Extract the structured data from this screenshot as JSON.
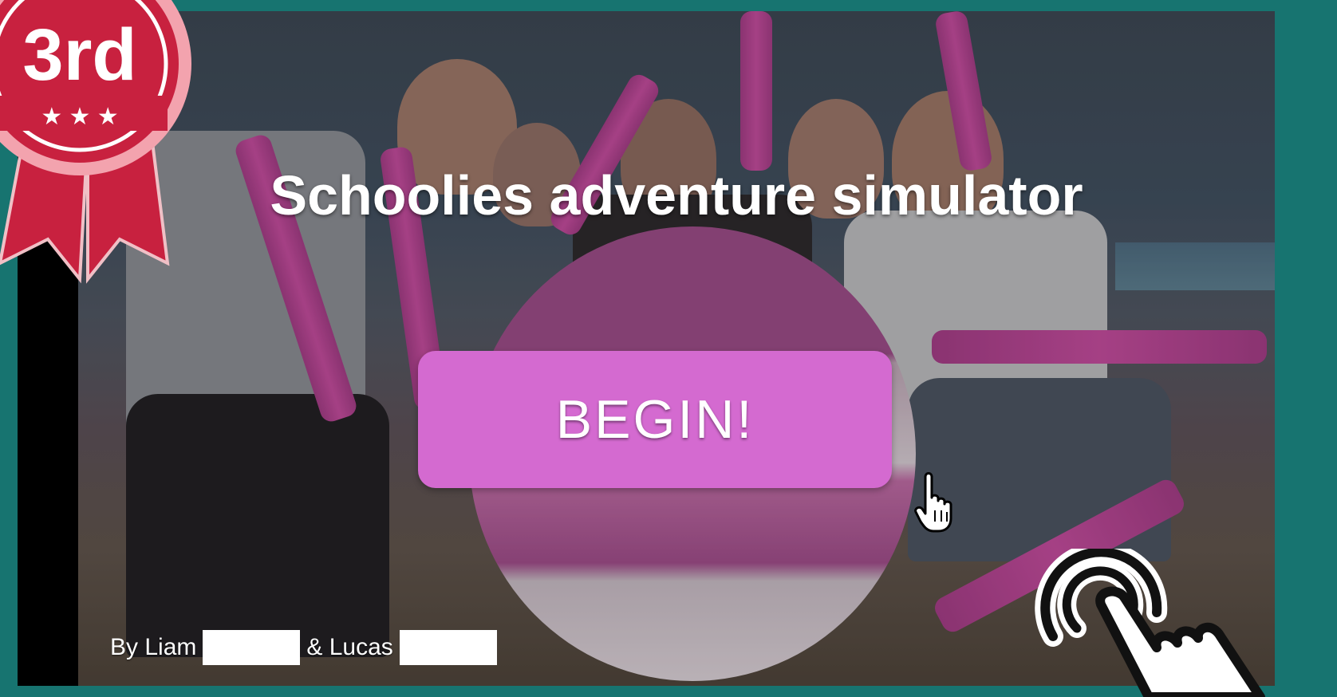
{
  "title": "Schoolies adventure simulator",
  "begin_label": "BEGIN!",
  "credits": {
    "by": "By Liam",
    "and": "& Lucas"
  },
  "badge": {
    "text": "3rd"
  },
  "colors": {
    "frame": "#177470",
    "button": "#d46ad0",
    "badge_red": "#c8213f",
    "badge_pink": "#f3a3ae"
  },
  "icons": {
    "cursor": "hand-pointer-icon",
    "touch": "touch-tap-icon"
  }
}
